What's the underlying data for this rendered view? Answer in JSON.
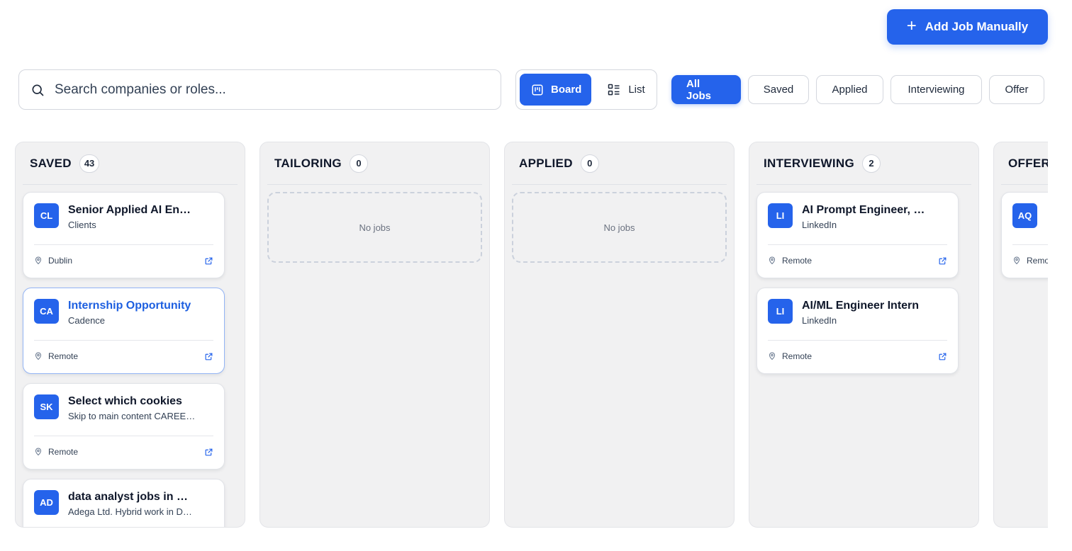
{
  "header": {
    "add_button_label": "Add Job Manually"
  },
  "search": {
    "placeholder": "Search companies or roles..."
  },
  "view_toggle": {
    "board_label": "Board",
    "list_label": "List",
    "active": "Board"
  },
  "filters": [
    {
      "label": "All Jobs",
      "active": true
    },
    {
      "label": "Saved",
      "active": false
    },
    {
      "label": "Applied",
      "active": false
    },
    {
      "label": "Interviewing",
      "active": false
    },
    {
      "label": "Offer",
      "active": false
    }
  ],
  "colors": {
    "accent": "#2563eb",
    "column_bg": "#f1f1f2"
  },
  "columns": [
    {
      "title": "SAVED",
      "count": "43",
      "cards": [
        {
          "initials": "CL",
          "title": "Senior Applied AI Engineer",
          "company": "Clients",
          "location": "Dublin"
        },
        {
          "initials": "CA",
          "title": "Internship Opportunity",
          "company": "Cadence",
          "location": "Remote"
        },
        {
          "initials": "SK",
          "title": "Select which cookies",
          "company": "Skip to main content CAREERS",
          "location": "Remote"
        },
        {
          "initials": "AD",
          "title": "data analyst jobs in Dublin",
          "company": "Adega Ltd. Hybrid work in Dublin",
          "location": ""
        }
      ]
    },
    {
      "title": "TAILORING",
      "count": "0",
      "empty_label": "No jobs"
    },
    {
      "title": "APPLIED",
      "count": "0",
      "empty_label": "No jobs"
    },
    {
      "title": "INTERVIEWING",
      "count": "2",
      "cards": [
        {
          "initials": "LI",
          "title": "AI Prompt Engineer, Trainee",
          "company": "LinkedIn",
          "location": "Remote"
        },
        {
          "initials": "LI",
          "title": "AI/ML Engineer Intern",
          "company": "LinkedIn",
          "location": "Remote"
        }
      ]
    },
    {
      "title": "OFFER",
      "cards": [
        {
          "initials": "AQ",
          "title": "",
          "company": "",
          "location": "Remote"
        }
      ]
    }
  ]
}
